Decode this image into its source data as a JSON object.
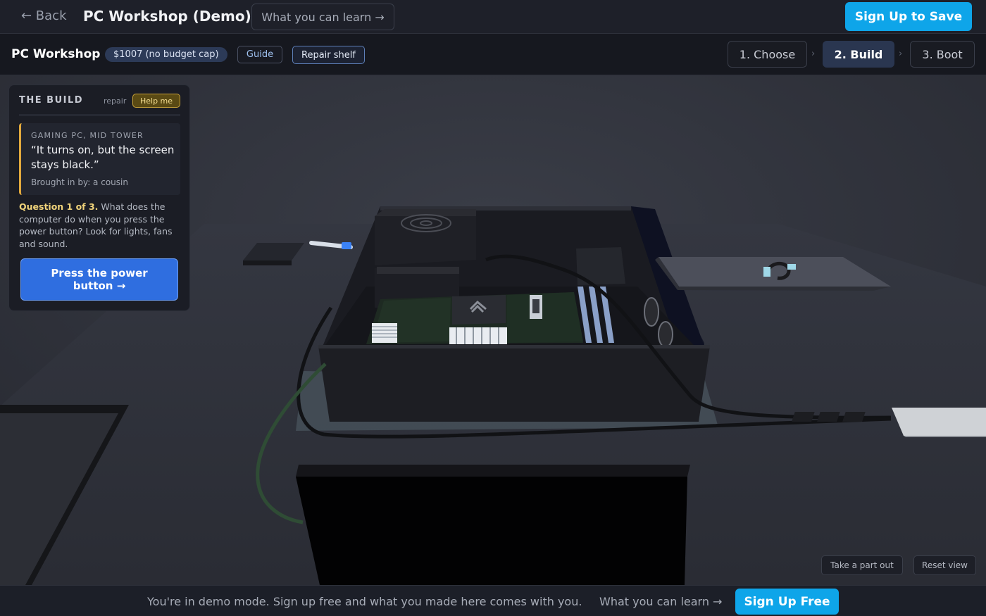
{
  "topbar": {
    "back_label": "← Back",
    "title": "PC Workshop (Demo)",
    "learn_label": "What you can learn →",
    "signup_label": "Sign Up to Save"
  },
  "subbar": {
    "title": "PC Workshop",
    "budget": "$1007 (no budget cap)",
    "guide_label": "Guide",
    "repair_shelf_label": "Repair shelf",
    "steps": [
      {
        "label": "1. Choose",
        "active": false
      },
      {
        "label": "2. Build",
        "active": true
      },
      {
        "label": "3. Boot",
        "active": false
      }
    ],
    "step_separator": "›"
  },
  "panel": {
    "heading": "THE BUILD",
    "mode": "repair",
    "help_label": "Help me",
    "case": {
      "tag": "GAMING PC, MID TOWER",
      "quote": "“It turns on, but the screen stays black.”",
      "from": "Brought in by: a cousin"
    },
    "question": {
      "number": "Question 1 of 3.",
      "text": "What does the computer do when you press the power button? Look for lights, fans and sound."
    },
    "action_label": "Press the power button →"
  },
  "scene": {
    "take_part_label": "Take a part out",
    "reset_view_label": "Reset view"
  },
  "banner": {
    "text": "You're in demo mode. Sign up free and what you made here comes with you.",
    "learn_label": "What you can learn →",
    "signup_label": "Sign Up Free"
  },
  "colors": {
    "accent": "#0ea5e9",
    "primary_action": "#2f6ee0",
    "help_gold": "#c8a239",
    "active_step": "#2a3650"
  }
}
